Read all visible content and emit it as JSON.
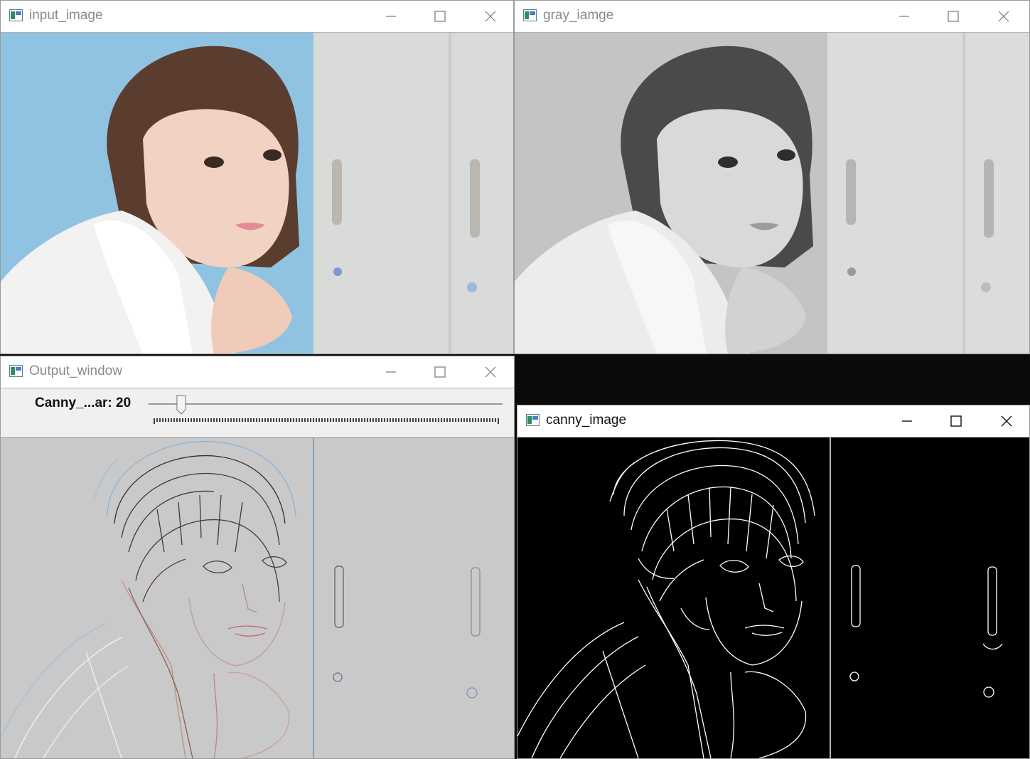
{
  "windows": {
    "input": {
      "title": "input_image"
    },
    "gray": {
      "title": "gray_iamge"
    },
    "output": {
      "title": "Output_window"
    },
    "canny": {
      "title": "canny_image"
    }
  },
  "trackbar": {
    "label": "Canny_...ar: 20",
    "value": 20,
    "max": 255
  },
  "icons": {
    "app": "opencv-window-icon",
    "minimize": "minimize-icon",
    "maximize": "maximize-icon",
    "close": "close-icon"
  },
  "colors": {
    "desktop": "#0b0b0b",
    "toolbar": "#f0f0f0",
    "output_background": "#c9c9c9",
    "canny_background": "#000000",
    "photo_wall": "#8fc3e1"
  }
}
